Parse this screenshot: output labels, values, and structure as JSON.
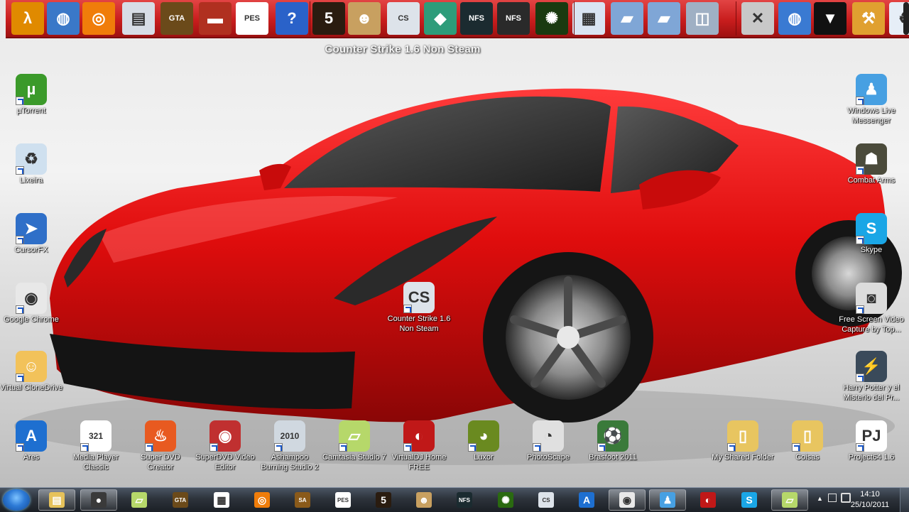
{
  "dock": {
    "tooltip": "Counter Strike 1.6 Non Steam",
    "icons": [
      {
        "name": "half-life-icon",
        "color": "#e08a00",
        "glyph": "λ"
      },
      {
        "name": "network-globe-icon",
        "color": "#3a78c8",
        "glyph": "◍"
      },
      {
        "name": "orange-swirl-icon",
        "color": "#f07d0a",
        "glyph": "◎"
      },
      {
        "name": "settings-window-icon",
        "color": "#d7dde6",
        "glyph": "▤"
      },
      {
        "name": "gta-san-andreas-icon",
        "color": "#6b4a1a",
        "glyph": "GTA"
      },
      {
        "name": "truck-game-icon",
        "color": "#b03020",
        "glyph": "▬"
      },
      {
        "name": "pes-2010-demo-icon",
        "color": "#ffffff",
        "glyph": "PES"
      },
      {
        "name": "help-icon",
        "color": "#2a62c9",
        "glyph": "?"
      },
      {
        "name": "resident-evil-5-icon",
        "color": "#2a1c10",
        "glyph": "5"
      },
      {
        "name": "soldier-game-icon",
        "color": "#c8a060",
        "glyph": "☻"
      },
      {
        "name": "counter-strike-icon",
        "color": "#dde3ea",
        "glyph": "CS"
      },
      {
        "name": "sims-icon",
        "color": "#2e9c7a",
        "glyph": "◆"
      },
      {
        "name": "nfs-icon",
        "color": "#1b2b30",
        "glyph": "NFS"
      },
      {
        "name": "nfs-dark-icon",
        "color": "#2a2a2a",
        "glyph": "NFS"
      },
      {
        "name": "green-crystal-icon",
        "color": "#1a3a10",
        "glyph": "✺"
      },
      {
        "name": "documents-icon",
        "color": "#d9e4f2",
        "glyph": "▦"
      },
      {
        "name": "folder-icon",
        "color": "#7fa6d6",
        "glyph": "▰"
      },
      {
        "name": "folder-blue-icon",
        "color": "#7fa6d6",
        "glyph": "▰"
      },
      {
        "name": "drive-icon",
        "color": "#9fb0c4",
        "glyph": "◫"
      },
      {
        "name": "tools-icon",
        "color": "#c8c8c8",
        "glyph": "✕"
      },
      {
        "name": "internet-globe-icon",
        "color": "#3a7ad2",
        "glyph": "◍"
      },
      {
        "name": "tshirt-icon",
        "color": "#111111",
        "glyph": "▼"
      },
      {
        "name": "hammer-icon",
        "color": "#e0a030",
        "glyph": "⚒"
      },
      {
        "name": "recycle-bin-icon",
        "color": "#e6eef7",
        "glyph": "♻"
      },
      {
        "name": "partial-icon",
        "color": "#222222",
        "glyph": ""
      }
    ]
  },
  "desktop_left": [
    {
      "name": "utorrent-icon",
      "label": "µTorrent",
      "color": "#3b9a2a",
      "glyph": "µ"
    },
    {
      "name": "recycle-bin-icon",
      "label": "Lixeira",
      "color": "#cfe0ef",
      "glyph": "♻"
    },
    {
      "name": "cursorfx-icon",
      "label": "CursorFX",
      "color": "#2f6fc8",
      "glyph": "➤"
    },
    {
      "name": "google-chrome-icon",
      "label": "Google Chrome",
      "color": "#e8e8e8",
      "glyph": "◉"
    },
    {
      "name": "virtual-clonedrive-icon",
      "label": "Virtual CloneDrive",
      "color": "#f2c25a",
      "glyph": "☺"
    }
  ],
  "desktop_right": [
    {
      "name": "windows-live-messenger-icon",
      "label": "Windows Live Messenger",
      "color": "#47a0e2",
      "glyph": "♟"
    },
    {
      "name": "combat-arms-icon",
      "label": "Combat Arms",
      "color": "#4b4b3b",
      "glyph": "☗"
    },
    {
      "name": "skype-icon",
      "label": "Skype",
      "color": "#1aa6e6",
      "glyph": "S"
    },
    {
      "name": "free-screen-video-capture-icon",
      "label": "Free Screen Video Capture by Top...",
      "color": "#dcdcdc",
      "glyph": "◙"
    },
    {
      "name": "harry-potter-icon",
      "label": "Harry Potter y el Misterio del Pr...",
      "color": "#3a4a5a",
      "glyph": "⚡"
    }
  ],
  "desktop_bottom": [
    {
      "name": "ares-icon",
      "label": "Ares",
      "color": "#1e6fd0",
      "glyph": "A"
    },
    {
      "name": "media-player-classic-icon",
      "label": "Media Player Classic",
      "color": "#ffffff",
      "glyph": "321"
    },
    {
      "name": "super-dvd-creator-icon",
      "label": "Super DVD Creator",
      "color": "#e85a20",
      "glyph": "♨"
    },
    {
      "name": "superdvd-video-editor-icon",
      "label": "SuperDVD Video Editor",
      "color": "#c03030",
      "glyph": "◉"
    },
    {
      "name": "ashampoo-burning-studio-icon",
      "label": "Ashampoo Burning Studio 2",
      "color": "#d0d8e0",
      "glyph": "2010"
    },
    {
      "name": "camtasia-studio-icon",
      "label": "Camtasia Studio 7",
      "color": "#b6d86a",
      "glyph": "▱"
    },
    {
      "name": "virtualdj-icon",
      "label": "VirtualDJ Home FREE",
      "color": "#c01818",
      "glyph": "◐"
    },
    {
      "name": "luxor-icon",
      "label": "Luxor",
      "color": "#6a8a20",
      "glyph": "◕"
    },
    {
      "name": "photoscape-icon",
      "label": "PhotoScape",
      "color": "#e0e0e0",
      "glyph": "◔"
    },
    {
      "name": "brasfoot-icon",
      "label": "Brasfoot 2011",
      "color": "#3a7a3a",
      "glyph": "⚽"
    },
    {
      "name": "shared-folder-icon",
      "label": "My Shared Folder",
      "color": "#e8c560",
      "glyph": "▯"
    },
    {
      "name": "coisas-folder-icon",
      "label": "Coisas",
      "color": "#e8c560",
      "glyph": "▯"
    },
    {
      "name": "project64-icon",
      "label": "Project64 1.6",
      "color": "#ffffff",
      "glyph": "PJ"
    }
  ],
  "desktop_center": {
    "name": "counter-strike-shortcut-icon",
    "label": "Counter Strike 1.6 Non Steam",
    "color": "#dde3ea",
    "glyph": "CS"
  },
  "taskbar": {
    "items": [
      {
        "name": "taskbar-explorer",
        "color": "#e6c25a",
        "glyph": "▤",
        "active": true
      },
      {
        "name": "taskbar-camtasia-recorder",
        "color": "#3a3a3a",
        "glyph": "●",
        "active": true
      },
      {
        "name": "taskbar-camtasia",
        "color": "#b6d86a",
        "glyph": "▱",
        "active": false
      },
      {
        "name": "taskbar-gta",
        "color": "#6b4a1a",
        "glyph": "GTA",
        "active": false
      },
      {
        "name": "taskbar-document",
        "color": "#ffffff",
        "glyph": "▦",
        "active": false
      },
      {
        "name": "taskbar-orange-swirl",
        "color": "#f07d0a",
        "glyph": "◎",
        "active": false
      },
      {
        "name": "taskbar-gta-sa",
        "color": "#8a5a1a",
        "glyph": "SA",
        "active": false
      },
      {
        "name": "taskbar-pes",
        "color": "#ffffff",
        "glyph": "PES",
        "active": false
      },
      {
        "name": "taskbar-resident-evil",
        "color": "#2a1c10",
        "glyph": "5",
        "active": false
      },
      {
        "name": "taskbar-soldier-game",
        "color": "#c8a060",
        "glyph": "☻",
        "active": false
      },
      {
        "name": "taskbar-nfs",
        "color": "#1b2b30",
        "glyph": "NFS",
        "active": false
      },
      {
        "name": "taskbar-green-crystal",
        "color": "#2a6a10",
        "glyph": "✺",
        "active": false
      },
      {
        "name": "taskbar-counter-strike",
        "color": "#dde3ea",
        "glyph": "CS",
        "active": false
      },
      {
        "name": "taskbar-ares",
        "color": "#1e6fd0",
        "glyph": "A",
        "active": false
      },
      {
        "name": "taskbar-chrome",
        "color": "#e8e8e8",
        "glyph": "◉",
        "active": true
      },
      {
        "name": "taskbar-messenger",
        "color": "#47a0e2",
        "glyph": "♟",
        "active": true
      },
      {
        "name": "taskbar-virtualdj",
        "color": "#c01818",
        "glyph": "◐",
        "active": false
      },
      {
        "name": "taskbar-skype",
        "color": "#1aa6e6",
        "glyph": "S",
        "active": false
      },
      {
        "name": "taskbar-camtasia-2",
        "color": "#b6d86a",
        "glyph": "▱",
        "active": true
      }
    ],
    "clock_time": "14:10",
    "clock_date": "25/10/2011"
  }
}
